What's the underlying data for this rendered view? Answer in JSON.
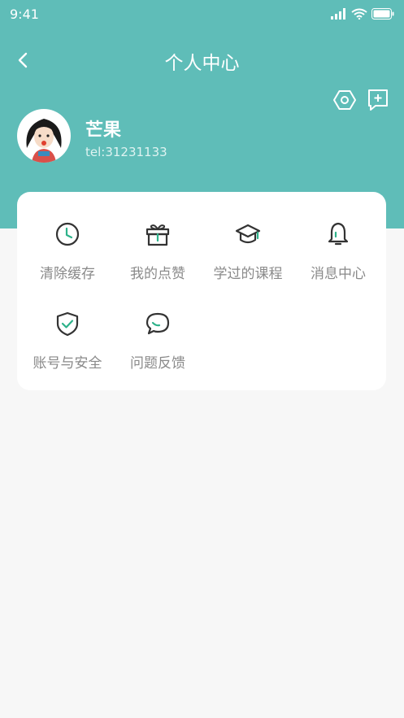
{
  "status_bar": {
    "time": "9:41",
    "icons": [
      "signal-icon",
      "wifi-icon",
      "battery-icon"
    ]
  },
  "nav": {
    "back_icon": "chevron-left-icon",
    "title": "个人中心"
  },
  "header_actions": {
    "icons": [
      "settings-hexagon-icon",
      "feedback-add-icon"
    ]
  },
  "profile": {
    "name": "芒果",
    "phone": "tel:31231133"
  },
  "menu": {
    "items": [
      {
        "label": "清除缓存",
        "icon": "clock-icon"
      },
      {
        "label": "我的点赞",
        "icon": "gift-icon"
      },
      {
        "label": "学过的课程",
        "icon": "graduation-cap-icon"
      },
      {
        "label": "消息中心",
        "icon": "bell-icon"
      },
      {
        "label": "账号与安全",
        "icon": "shield-check-icon"
      },
      {
        "label": "问题反馈",
        "icon": "chat-bubble-icon"
      }
    ]
  },
  "colors": {
    "header": "#5fbdb8",
    "icon_stroke": "#333333",
    "accent": "#2db28a",
    "label": "#8a8a8a",
    "page_bg": "#f7f7f7"
  }
}
